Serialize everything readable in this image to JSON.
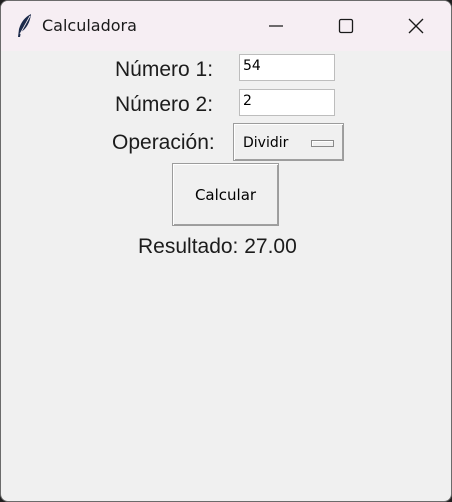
{
  "window": {
    "title": "Calculadora",
    "icon": "feather-icon",
    "controls": [
      "minimize-icon",
      "maximize-icon",
      "close-icon"
    ]
  },
  "form": {
    "numero1_label": "Número 1:",
    "numero1_value": "54",
    "numero2_label": "Número 2:",
    "numero2_value": "2",
    "operacion_label": "Operación:",
    "operacion_selected": "Dividir",
    "calcular_label": "Calcular",
    "resultado": "Resultado: 27.00"
  }
}
